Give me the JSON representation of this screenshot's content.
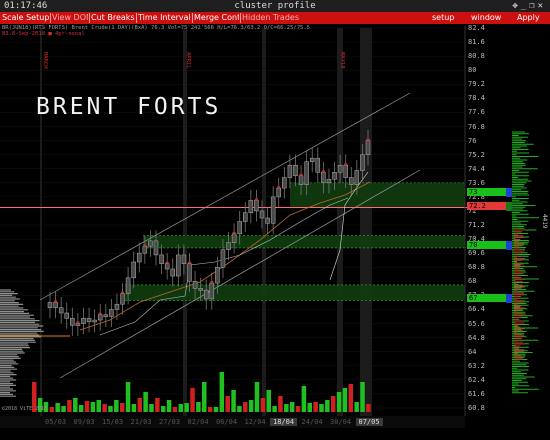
{
  "window": {
    "clock": "01:17:46",
    "title": "cluster profile",
    "controls": [
      "✥",
      "_",
      "❐",
      "✕"
    ]
  },
  "menu": {
    "left": [
      "Scale Setup",
      "View DOM",
      "Cut Breaks",
      "Time Interval",
      "Merge Contr",
      "Hidden Trades"
    ],
    "right": [
      "setup",
      "window",
      "Apply"
    ]
  },
  "info": {
    "line1": "BR(JUN18)(RTS FORTS) Brent Crude(1 DAY)(BxA) 76.3 Vol=75'242'566 H/L=76.3/63.2 O/C=66.25/75.5",
    "line2": "83.8-Sep-2018 ■ 4pr-nonal"
  },
  "overlay_title": "BRENT FORTS",
  "month_markers": [
    "MARCH",
    "APRIL",
    "MAY18"
  ],
  "price_axis": [
    "82.4",
    "81.6",
    "80.8",
    "80",
    "79.2",
    "78.4",
    "77.6",
    "76.8",
    "76",
    "75.2",
    "74.4",
    "73.6",
    "72.8",
    "72",
    "71.2",
    "70.4",
    "69.6",
    "68.8",
    "68",
    "67.2",
    "66.4",
    "65.6",
    "64.8",
    "64",
    "63.2",
    "62.4",
    "61.6",
    "60.8"
  ],
  "price_flags": [
    {
      "label": "73",
      "color": "#19c019"
    },
    {
      "label": "72.2",
      "color": "#e03a3a"
    },
    {
      "label": "70",
      "color": "#19c019"
    },
    {
      "label": "67",
      "color": "#19c019"
    }
  ],
  "date_axis": [
    "05/03",
    "09/03",
    "15/03",
    "21/03",
    "27/03",
    "02/04",
    "06/04",
    "12/04",
    "18/04",
    "24/04",
    "30/04",
    "07/05"
  ],
  "selected_dates": [
    "18/04",
    "07/05"
  ],
  "side_label": "4419",
  "copyright": "©2018 ViTE\n2018"
}
